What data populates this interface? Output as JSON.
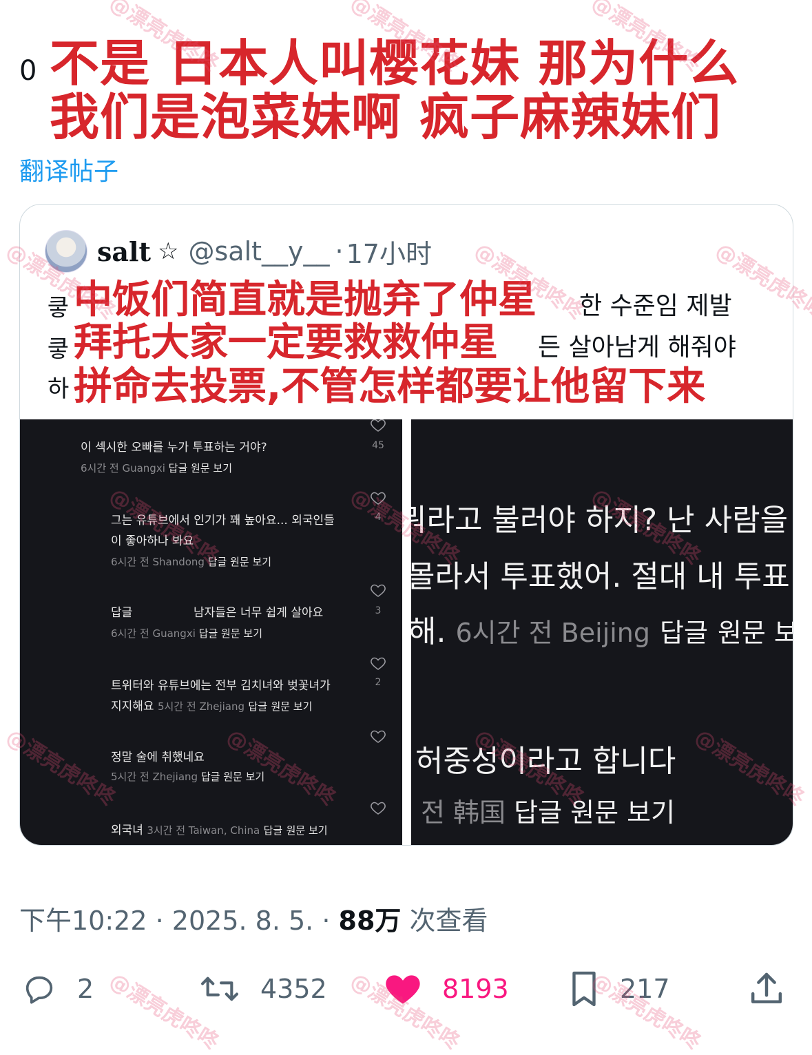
{
  "post": {
    "prefix": "0",
    "caption_line1": "不是 日本人叫樱花妹 那为什么",
    "caption_line2": "我们是泡菜妹啊 疯子麻辣妹们",
    "translate_link": "翻译帖子"
  },
  "quote": {
    "name": "salt",
    "star": "☆",
    "handle": "@salt__y__",
    "separator": "·",
    "time": "17小时",
    "korean_right": [
      "한 수준임 제발",
      "든 살아남게 해줘야"
    ],
    "korean_left": [
      "킇",
      "킇",
      "하"
    ],
    "chinese_overlay": [
      "中饭们简直就是抛弃了仲星",
      "拜托大家一定要救救仲星",
      "拼命去投票,不管怎样都要让他留下来"
    ]
  },
  "left_screenshot": {
    "comments": [
      {
        "text": "이 섹시한 오빠를 누가 투표하는 거야?",
        "meta_plain": "6시간 전 Guangxi",
        "reply": "답글",
        "view": "원문 보기",
        "likes": "45"
      },
      {
        "text": "그는 유튜브에서 인기가 꽤 높아요... 외국인들",
        "text2": "이 좋아하나 봐요",
        "meta_plain": "6시간 전 Shandong",
        "reply": "답글",
        "view": "원문 보기",
        "likes": "4"
      },
      {
        "text": "답글",
        "text_b": "남자들은 너무 쉽게 살아요",
        "meta_plain": "6시간 전 Guangxi",
        "reply": "답글",
        "view": "원문 보기",
        "likes": "3"
      },
      {
        "text": "트위터와 유튜브에는 전부 김치녀와 벚꽃녀가",
        "text2": "지지해요",
        "meta_plain": "5시간 전 Zhejiang",
        "reply": "답글",
        "view": "원문 보기",
        "likes": "2"
      },
      {
        "text": "정말 술에 취했네요",
        "meta_plain": "5시간 전 Zhejiang",
        "reply": "답글",
        "view": "원문 보기",
        "likes": ""
      },
      {
        "text": "외국녀",
        "meta_plain": "3시간 전 Taiwan, China",
        "reply": "답글",
        "view": "원문 보기",
        "likes": ""
      }
    ]
  },
  "right_screenshot": {
    "line1": "뭐라고 불러야 하지? 난 사람을",
    "line2": "몰라서 투표했어. 절대 내 투표",
    "line3_main": "해.",
    "line3_meta": "6시간 전 Beijing",
    "line3_reply": "답글",
    "line3_view": "원문 보",
    "line4": "허중성이라고 합니다",
    "line5_meta": "전 韩国",
    "line5_reply": "답글",
    "line5_view": "원문 보기"
  },
  "footer": {
    "time": "下午10:22",
    "sep1": "·",
    "date": "2025. 8. 5.",
    "sep2": "·",
    "views": "88万",
    "views_label": "次查看"
  },
  "actions": {
    "replies": "2",
    "retweets": "4352",
    "likes": "8193",
    "bookmarks": "217"
  },
  "colors": {
    "caption_red": "#d7262c",
    "link_blue": "#1d9bf0",
    "like_pink": "#f91880",
    "muted_gray": "#536471"
  },
  "watermark": "@漂亮虎咚咚"
}
